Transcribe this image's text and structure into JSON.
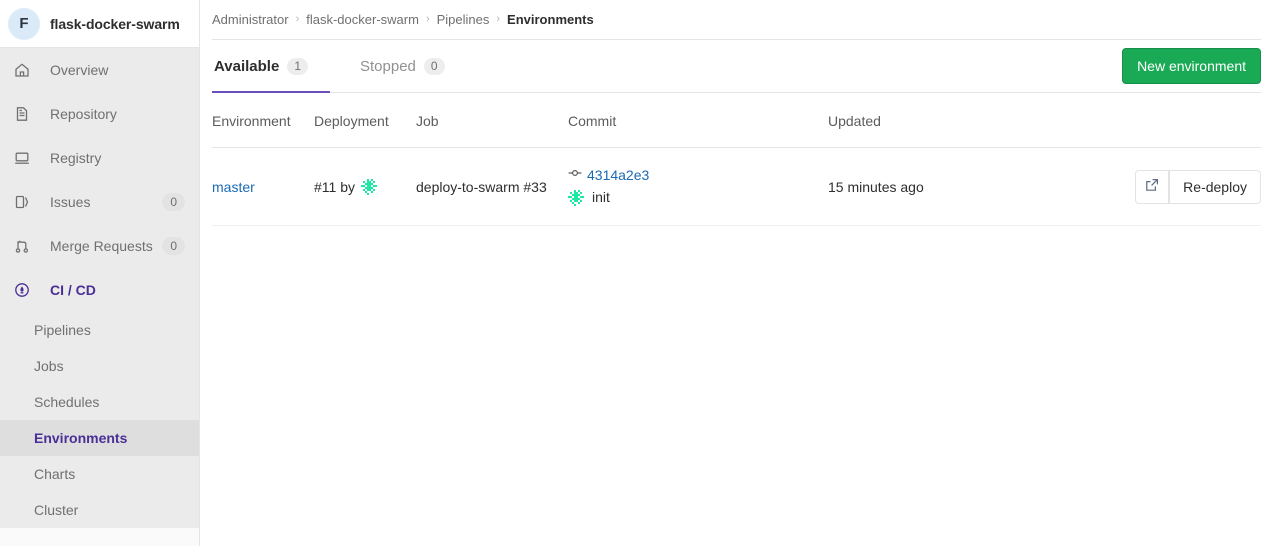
{
  "sidebar": {
    "project": {
      "initial": "F",
      "name": "flask-docker-swarm"
    },
    "items": [
      {
        "label": "Overview",
        "icon": "home-icon",
        "badge": null
      },
      {
        "label": "Repository",
        "icon": "document-icon",
        "badge": null
      },
      {
        "label": "Registry",
        "icon": "monitor-icon",
        "badge": null
      },
      {
        "label": "Issues",
        "icon": "issues-icon",
        "badge": "0"
      },
      {
        "label": "Merge Requests",
        "icon": "merge-request-icon",
        "badge": "0"
      },
      {
        "label": "CI / CD",
        "icon": "rocket-icon",
        "badge": null
      }
    ],
    "cicd_sub": [
      {
        "label": "Pipelines",
        "active": false
      },
      {
        "label": "Jobs",
        "active": false
      },
      {
        "label": "Schedules",
        "active": false
      },
      {
        "label": "Environments",
        "active": true
      },
      {
        "label": "Charts",
        "active": false
      },
      {
        "label": "Cluster",
        "active": false
      }
    ]
  },
  "breadcrumb": {
    "items": [
      "Administrator",
      "flask-docker-swarm",
      "Pipelines"
    ],
    "current": "Environments",
    "separator": "›"
  },
  "tabs": [
    {
      "label": "Available",
      "count": "1",
      "active": true
    },
    {
      "label": "Stopped",
      "count": "0",
      "active": false
    }
  ],
  "actions": {
    "new_environment": "New environment"
  },
  "table": {
    "headers": [
      "Environment",
      "Deployment",
      "Job",
      "Commit",
      "Updated",
      ""
    ],
    "rows": [
      {
        "environment": "master",
        "deployment": "#11 by",
        "deployment_avatar": "user-identicon",
        "job": "deploy-to-swarm #33",
        "commit_sha": "4314a2e3",
        "commit_message": "init",
        "commit_avatar": "user-identicon",
        "updated": "15 minutes ago",
        "external_link_label": "external-link",
        "redeploy_label": "Re-deploy"
      }
    ]
  },
  "colors": {
    "brand_purple": "#6b4fbb",
    "active_purple": "#4b2e96",
    "green": "#1aaa55",
    "link_blue": "#1b69b6",
    "sidebar_bg": "#ebebeb"
  }
}
